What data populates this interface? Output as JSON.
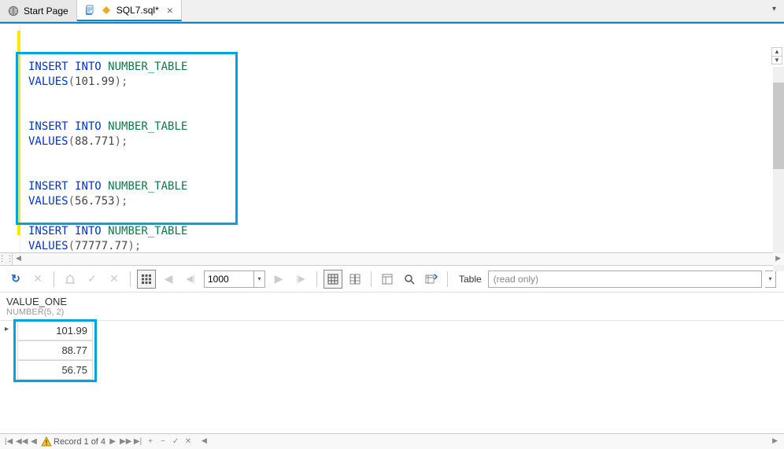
{
  "tabs": {
    "start": "Start Page",
    "active": "SQL7.sql*"
  },
  "code": {
    "s1_a": "INSERT",
    "s1_b": "INTO",
    "s1_c": "NUMBER_TABLE",
    "s1_v": "VALUES",
    "s1_n": "101.99",
    "s2_a": "INSERT",
    "s2_b": "INTO",
    "s2_c": "NUMBER_TABLE",
    "s2_v": "VALUES",
    "s2_n": "88.771",
    "s3_a": "INSERT",
    "s3_b": "INTO",
    "s3_c": "NUMBER_TABLE",
    "s3_v": "VALUES",
    "s3_n": "56.753",
    "s4_a": "INSERT",
    "s4_b": "INTO",
    "s4_c": "NUMBER_TABLE",
    "s4_v": "VALUES",
    "s4_n": "77777.77"
  },
  "toolbar": {
    "rows": "1000",
    "table_label": "Table",
    "readonly": "(read only)"
  },
  "grid": {
    "col_name": "VALUE_ONE",
    "col_type": "NUMBER(5, 2)",
    "r1": "101.99",
    "r2": "88.77",
    "r3": "56.75"
  },
  "footer": {
    "record": "Record 1 of 4"
  },
  "icons": {
    "plus": "+",
    "minus": "−",
    "caret": "▾",
    "tri_r": "▶",
    "tri_l": "◀",
    "first": "⏮",
    "last": "⏭",
    "check": "✓",
    "x": "✕",
    "refresh": "↻"
  }
}
